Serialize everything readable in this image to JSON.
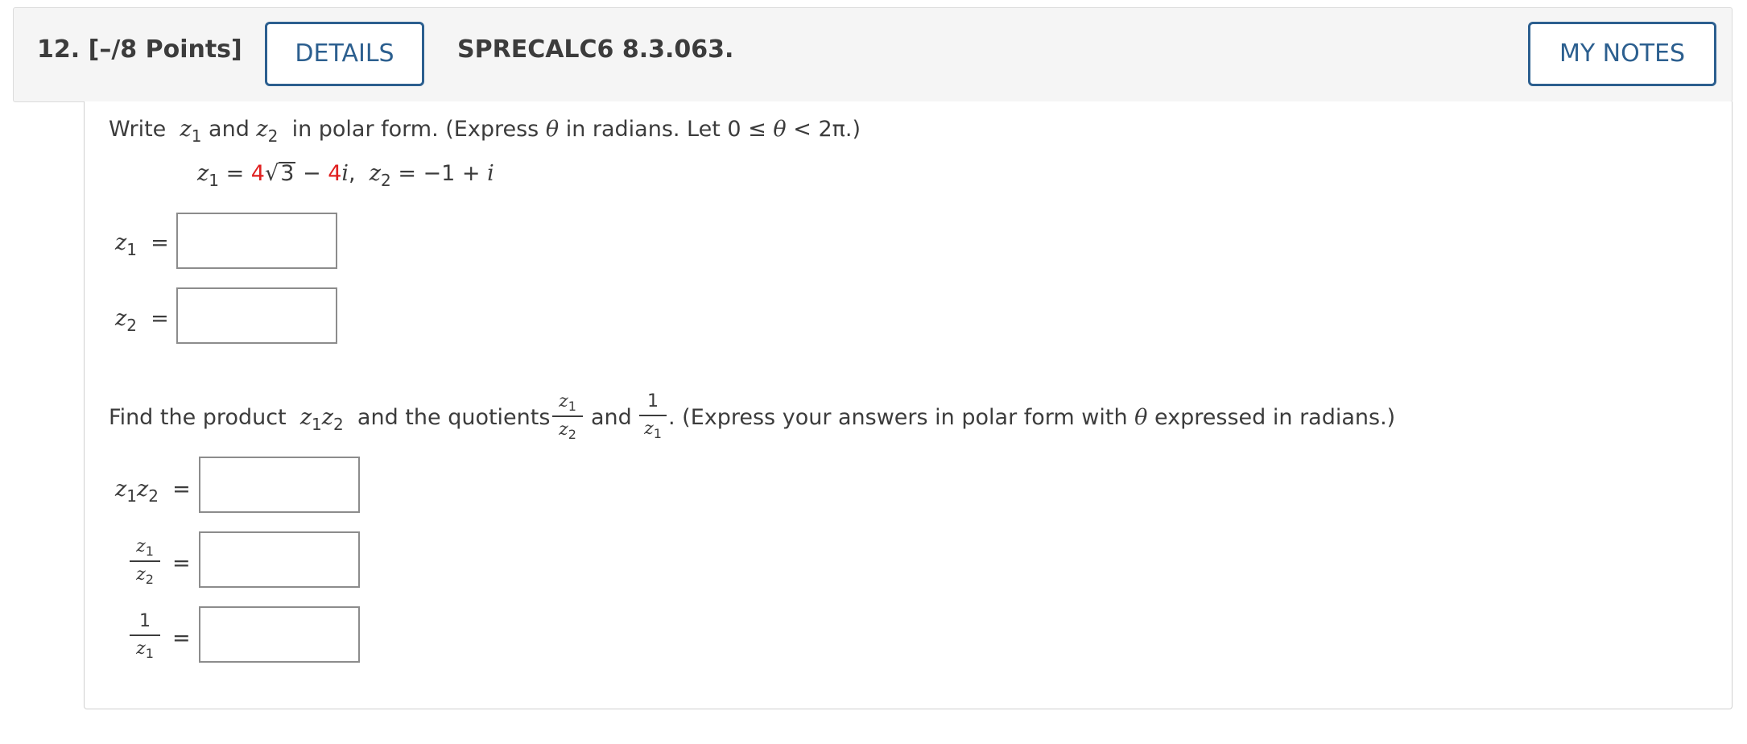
{
  "header": {
    "question_number": "12.",
    "points": "[–/8 Points]",
    "details_label": "DETAILS",
    "course_code": "SPRECALC6 8.3.063.",
    "my_notes_label": "MY NOTES"
  },
  "part1": {
    "instruction_prefix": "Write",
    "instruction_and": "and",
    "instruction_rest": "in polar form. (Express",
    "instruction_tail": "in radians. Let 0 ≤",
    "instruction_end": "< 2π.)",
    "given": {
      "z1_coef_a": "4",
      "sqrt_arg": "3",
      "minus": "−",
      "z1_coef_b": "4",
      "z2_value": "−1 + ",
      "imag_unit": "i"
    },
    "fields": [
      {
        "label_var": "z",
        "label_sub": "1",
        "value": ""
      },
      {
        "label_var": "z",
        "label_sub": "2",
        "value": ""
      }
    ]
  },
  "part2": {
    "instruction_prefix": "Find the product",
    "instruction_mid": "and the quotients",
    "instruction_and": "and",
    "instruction_rest": ". (Express your answers in polar form with",
    "instruction_end": "expressed in radians.)",
    "one": "1",
    "fields": [
      {
        "name": "z1z2",
        "value": ""
      },
      {
        "name": "z1-over-z2",
        "value": ""
      },
      {
        "name": "one-over-z1",
        "value": ""
      }
    ]
  },
  "symbols": {
    "z": "z",
    "theta": "θ",
    "sub1": "1",
    "sub2": "2",
    "equals": "=",
    "i": "i"
  }
}
